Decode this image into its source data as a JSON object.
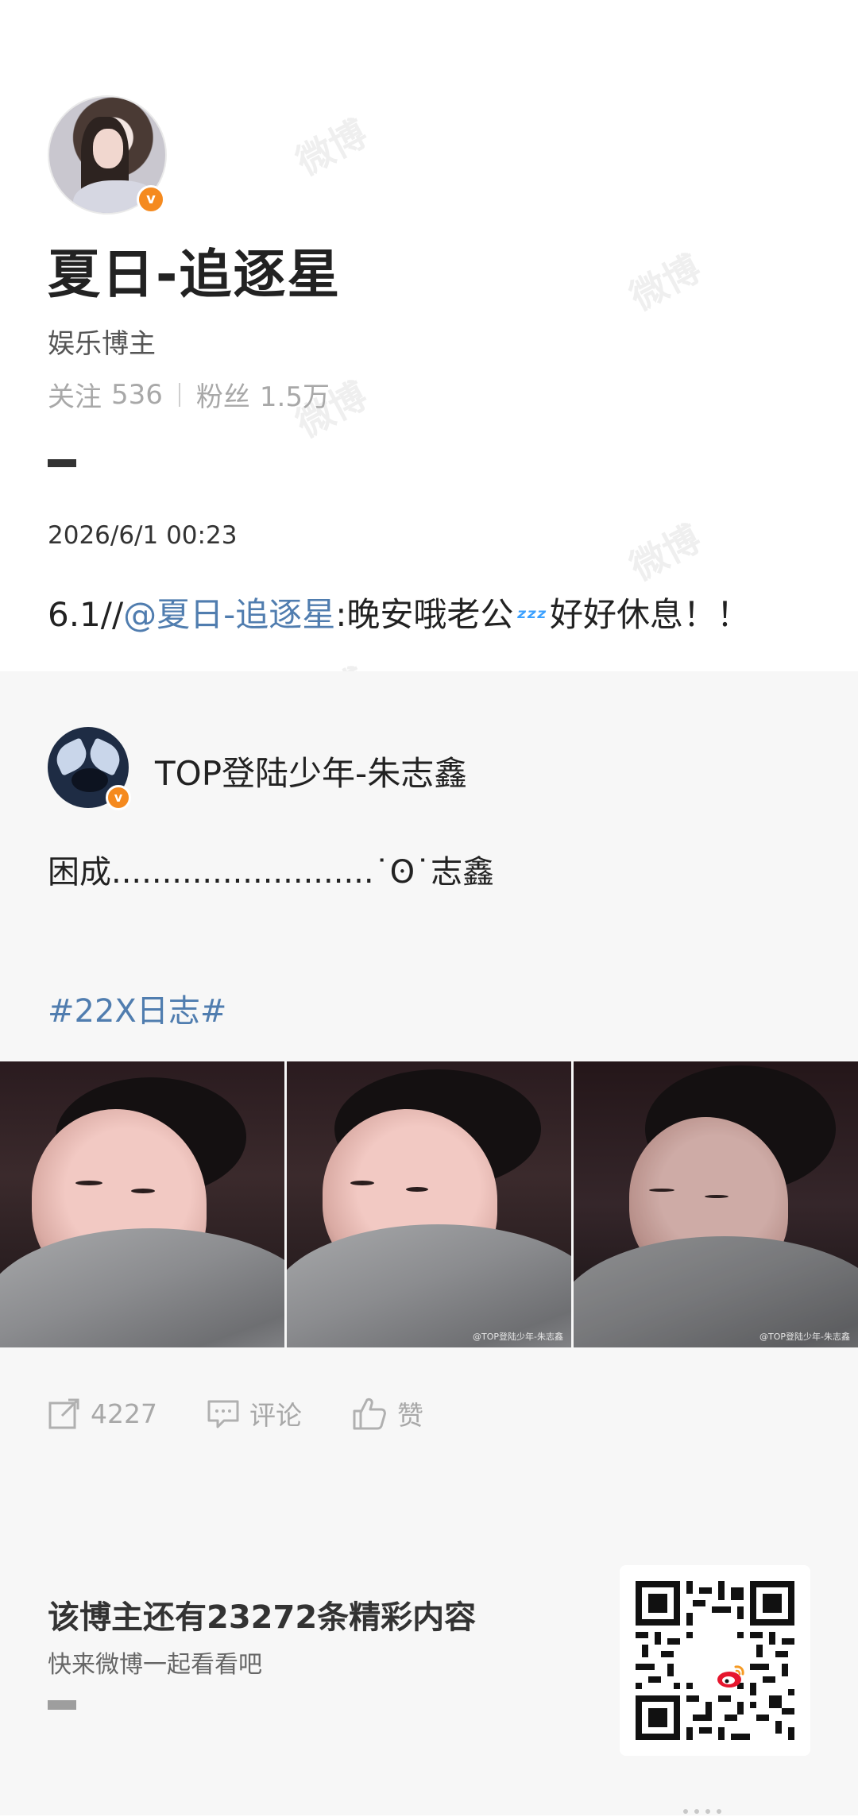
{
  "watermark": "微博",
  "profile": {
    "name": "夏日-追逐星",
    "title": "娱乐博主",
    "following_label": "关注",
    "following_count": "536",
    "followers_label": "粉丝",
    "followers_count": "1.5万",
    "verified_badge": "v"
  },
  "post": {
    "time": "2026/6/1 00:23",
    "text_prefix": "6.1//",
    "mention": "@夏日-追逐星",
    "text_main": ":晚安哦老公",
    "emoji": "zzz-icon",
    "text_suffix": "好好休息！！"
  },
  "repost": {
    "user": "TOP登陆少年-朱志鑫",
    "text": "困成..........................˙ʘ˙志鑫",
    "hashtag": "#22X日志#",
    "photo_watermark": "@TOP登陆少年-朱志鑫"
  },
  "actions": {
    "share_count": "4227",
    "comment_label": "评论",
    "like_label": "赞"
  },
  "footer": {
    "title": "该博主还有23272条精彩内容",
    "subtitle": "快来微博一起看看吧"
  },
  "colors": {
    "link": "#507daf",
    "badge": "#f58a1f",
    "muted": "#a8a8a8"
  }
}
